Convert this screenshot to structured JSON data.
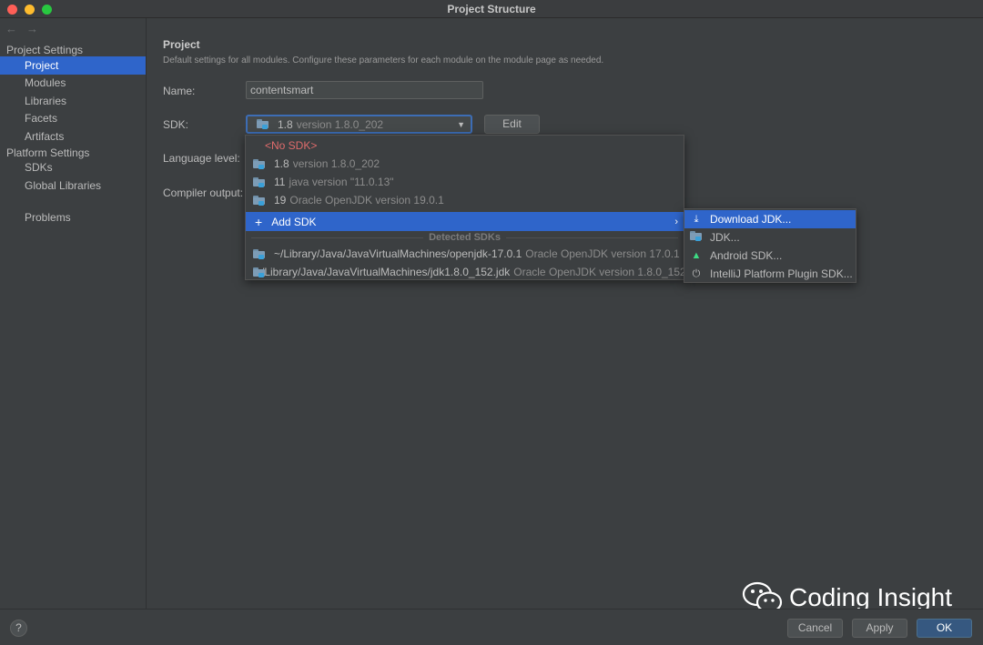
{
  "window": {
    "title": "Project Structure"
  },
  "nav": {
    "back": "←",
    "forward": "→"
  },
  "sidebar": {
    "group_project": "Project Settings",
    "group_platform": "Platform Settings",
    "items": [
      {
        "label": "Project"
      },
      {
        "label": "Modules"
      },
      {
        "label": "Libraries"
      },
      {
        "label": "Facets"
      },
      {
        "label": "Artifacts"
      },
      {
        "label": "SDKs"
      },
      {
        "label": "Global Libraries"
      },
      {
        "label": "Problems"
      }
    ]
  },
  "main": {
    "title": "Project",
    "description": "Default settings for all modules. Configure these parameters for each module on the module page as needed.",
    "name_label": "Name:",
    "name_value": "contentsmart",
    "sdk_label": "SDK:",
    "sdk_selected_name": "1.8",
    "sdk_selected_version": "version 1.8.0_202",
    "edit_label": "Edit",
    "language_level_label": "Language level:",
    "compiler_output_label": "Compiler output:"
  },
  "sdk_dropdown": {
    "no_sdk": "<No SDK>",
    "items": [
      {
        "name": "1.8",
        "detail": "version 1.8.0_202"
      },
      {
        "name": "11",
        "detail": "java version \"11.0.13\""
      },
      {
        "name": "19",
        "detail": "Oracle OpenJDK version 19.0.1"
      }
    ],
    "add_sdk": "Add SDK",
    "detected_title": "Detected SDKs",
    "detected": [
      {
        "path": "~/Library/Java/JavaVirtualMachines/openjdk-17.0.1",
        "detail": "Oracle OpenJDK version 17.0.1"
      },
      {
        "path": "/Library/Java/JavaVirtualMachines/jdk1.8.0_152.jdk",
        "detail": "Oracle OpenJDK version 1.8.0_152"
      }
    ]
  },
  "add_sdk_submenu": {
    "items": [
      {
        "label": "Download JDK...",
        "icon": "download-icon"
      },
      {
        "label": "JDK...",
        "icon": "folder-icon"
      },
      {
        "label": "Android SDK...",
        "icon": "android-icon"
      },
      {
        "label": "IntelliJ Platform Plugin SDK...",
        "icon": "plugin-icon"
      }
    ]
  },
  "footer": {
    "help": "?",
    "cancel": "Cancel",
    "apply": "Apply",
    "ok": "OK"
  },
  "watermark": {
    "text": "Coding Insight"
  },
  "colors": {
    "accent": "#2f65ca",
    "background": "#3c3f41",
    "no_sdk": "#e06c6c",
    "primary_button": "#365880"
  }
}
